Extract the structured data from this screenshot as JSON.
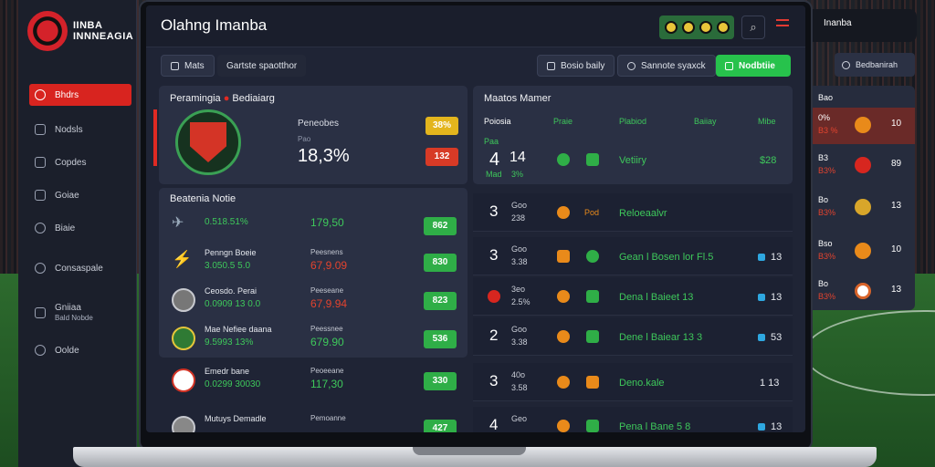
{
  "brand": {
    "line1": "IINBA",
    "line2": "INNNEAGIA"
  },
  "sidebar": {
    "items": [
      {
        "label": "Bhdrs",
        "icon": "target-icon",
        "active": true
      },
      {
        "label": "Nodsls",
        "icon": "shield-icon"
      },
      {
        "label": "Copdes",
        "icon": "card-icon"
      },
      {
        "label": "Goiae",
        "icon": "image-icon"
      },
      {
        "label": "Biaie",
        "icon": "clock-icon"
      },
      {
        "label": "Consaspale",
        "icon": "gear-icon"
      },
      {
        "label": "Gniiaa",
        "sub": "Bald Nobde",
        "icon": "list-icon"
      },
      {
        "label": "Oolde",
        "icon": "settings-icon"
      }
    ]
  },
  "header": {
    "title": "Olahng Imanba"
  },
  "filters": {
    "mats": "Mats",
    "sport_option": "Gartste spaotthor",
    "basic_daily": "Bosio baily",
    "search": "Sannote syaxck",
    "highlight": "Nodbtiie"
  },
  "featured": {
    "title": "Peramingia",
    "title_b": "Bediaiarg",
    "label": "Peneobes",
    "sub": "Pao",
    "value": "18,3%",
    "odd1": "38%",
    "odd2": "132"
  },
  "list": {
    "title": "Beatenia Notie",
    "rows": [
      {
        "name": "",
        "sub": "0.518.51%",
        "col2": "",
        "val": "179,50",
        "odd": "862",
        "val_color": "green"
      },
      {
        "name": "Penngn Boeie",
        "sub": "3.050.5 5.0",
        "col2": "Peesnens",
        "val": "67,9.09",
        "odd": "830",
        "val_color": "red"
      },
      {
        "name": "Ceosdo. Perai",
        "sub": "0.0909 13 0.0",
        "col2": "Peeseane",
        "val": "67,9.94",
        "odd": "823",
        "val_color": "red"
      },
      {
        "name": "Mae Nefiee daana",
        "sub": "9.5993 13%",
        "col2": "Peessnee",
        "val": "679.90",
        "odd": "536",
        "val_color": "green"
      },
      {
        "name": "Emedr bane",
        "sub": "0.0299 30030",
        "col2": "Peoeeane",
        "val": "117,30",
        "odd": "330",
        "val_color": "green"
      },
      {
        "name": "Mutuys Demadle",
        "sub": "",
        "col2": "Pemoanne",
        "val": "",
        "odd": "427",
        "val_color": "green"
      }
    ]
  },
  "matches": {
    "title": "Maatos Mamer",
    "headers": [
      "Poiosia",
      "Praie",
      "Plabiod",
      "Baiiay",
      "Mibe"
    ],
    "featured_row": {
      "score": "4",
      "score_sub": "Mad",
      "big2": "14",
      "small2": "3%",
      "text": "Vetiiry",
      "value": "$28",
      "head": "Paa"
    },
    "rows": [
      {
        "score": "3",
        "top": "Goo",
        "bot": "238",
        "text": "Reloeaalvr",
        "num": "",
        "tag": "Pod"
      },
      {
        "score": "3",
        "top": "Goo",
        "bot": "3.38",
        "text": "Gean l Bosen lor Fl.5",
        "num": "13"
      },
      {
        "score": "",
        "top": "3eo",
        "bot": "2.5%",
        "text": "Dena l Baieet 13",
        "num": "13"
      },
      {
        "score": "2",
        "top": "Goo",
        "bot": "3.38",
        "text": "Dene l Baiear 13 3",
        "num": "53"
      },
      {
        "score": "3",
        "top": "40o",
        "bot": "3.58",
        "text": "Deno.kale",
        "num": "1 13"
      },
      {
        "score": "4",
        "top": "Geo",
        "bot": "",
        "text": "Pena l Bane 5 8",
        "num": "13"
      }
    ]
  },
  "right": {
    "overlay": "Inanba",
    "button": "Bedbanirah",
    "rows": [
      {
        "a": "Bao",
        "b": "",
        "d": ""
      },
      {
        "a": "0%",
        "b": "B3 %",
        "d": "10"
      },
      {
        "a": "B3",
        "b": "B3%",
        "d": "89"
      },
      {
        "a": "Bo",
        "b": "B3%",
        "d": "13"
      },
      {
        "a": "Bso",
        "b": "B3%",
        "d": "10"
      },
      {
        "a": "Bo",
        "b": "B3%",
        "d": "13"
      }
    ]
  }
}
